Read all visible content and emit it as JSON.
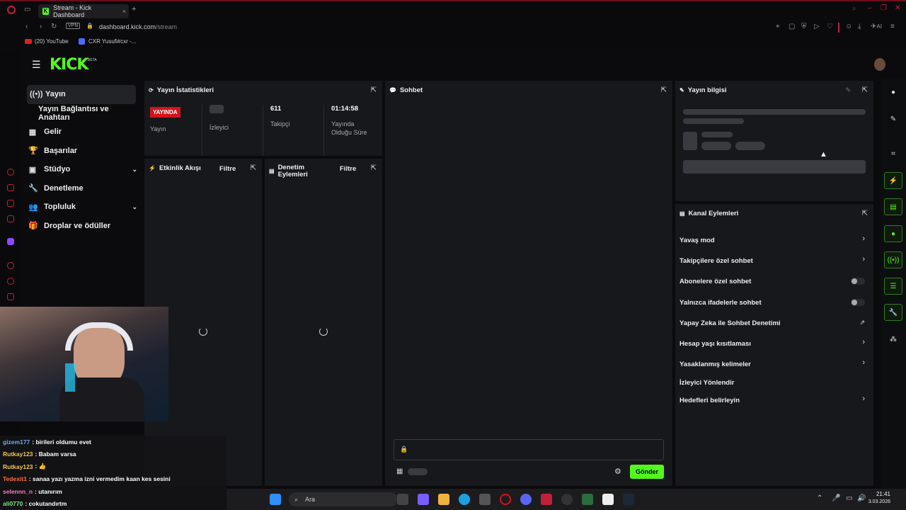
{
  "browser": {
    "tab_title": "Stream - Kick Dashboard",
    "tab_new": "+",
    "vpn": "VPN",
    "url_domain": "dashboard.kick.com",
    "url_path": "/stream",
    "ai_label": "AI",
    "bookmarks": [
      "(20) YouTube",
      "CXR Yusufi#cxr -..."
    ]
  },
  "logo": {
    "text": "KICK",
    "badge": "BETA"
  },
  "sidebar": {
    "items": [
      {
        "label": "Yayın",
        "icon": "broadcast-icon"
      },
      {
        "label": "Yayın Bağlantısı ve Anahtarı",
        "icon": ""
      },
      {
        "label": "Gelir",
        "icon": "revenue-icon"
      },
      {
        "label": "Başarılar",
        "icon": "trophy-icon"
      },
      {
        "label": "Stüdyo",
        "icon": "studio-icon"
      },
      {
        "label": "Denetleme",
        "icon": "wrench-icon"
      },
      {
        "label": "Topluluk",
        "icon": "community-icon"
      },
      {
        "label": "Droplar ve ödüller",
        "icon": "gift-icon"
      }
    ]
  },
  "stats": {
    "title": "Yayın İstatistikleri",
    "live_badge": "YAYINDA",
    "live_label": "Yayın",
    "viewers_label": "İzleyici",
    "followers_value": "611",
    "followers_label": "Takipçi",
    "uptime_value": "01:14:58",
    "uptime_label_1": "Yayında",
    "uptime_label_2": "Olduğu Süre"
  },
  "activity": {
    "title": "Etkinlik Akışı",
    "filter": "Filtre"
  },
  "modactions": {
    "title_1": "Denetim",
    "title_2": "Eylemleri",
    "filter": "Filtre"
  },
  "chat": {
    "title": "Sohbet",
    "send": "Gönder"
  },
  "streaminfo": {
    "title": "Yayın bilgisi"
  },
  "channel_actions": {
    "title": "Kanal Eylemleri",
    "rows": [
      {
        "label": "Yavaş mod",
        "control": "arrow"
      },
      {
        "label": "Takipçilere özel sohbet",
        "control": "arrow"
      },
      {
        "label": "Abonelere özel sohbet",
        "control": "toggle"
      },
      {
        "label": "Yalnızca ifadelerle sohbet",
        "control": "toggle"
      },
      {
        "label": "Yapay Zeka ile Sohbet Denetimi",
        "control": "external"
      },
      {
        "label": "Hesap yaşı kısıtlaması",
        "control": "arrow"
      },
      {
        "label": "Yasaklanmış kelimeler",
        "control": "arrow"
      },
      {
        "label": "İzleyici Yönlendir",
        "control": "none"
      },
      {
        "label": "Hedefleri belirleyin",
        "control": "arrow"
      }
    ]
  },
  "overlay_chat": [
    {
      "user": "gizem177",
      "color": "#6fa8ff",
      "msg": ": birileri oldumu evet"
    },
    {
      "user": "Rutkay123",
      "color": "#f2c94c",
      "msg": ": Babam varsa"
    },
    {
      "user": "Rutkay123",
      "color": "#f2c94c",
      "msg": ": 👍"
    },
    {
      "user": "Tedexit1",
      "color": "#ff6b3d",
      "msg": ": sanaa yazı yazma izni vermedim kaan kes sesini"
    },
    {
      "user": "selennn_n",
      "color": "#ff7ab6",
      "msg": ": utanırım"
    },
    {
      "user": "ali0770",
      "color": "#7ee787",
      "msg": ": cokutandırtm"
    }
  ],
  "taskbar": {
    "search": "Ara",
    "time": "21:41",
    "date": "3.03.2026"
  },
  "colors": {
    "brand": "#53fc18",
    "live": "#d4131d",
    "panel": "#17181b"
  }
}
